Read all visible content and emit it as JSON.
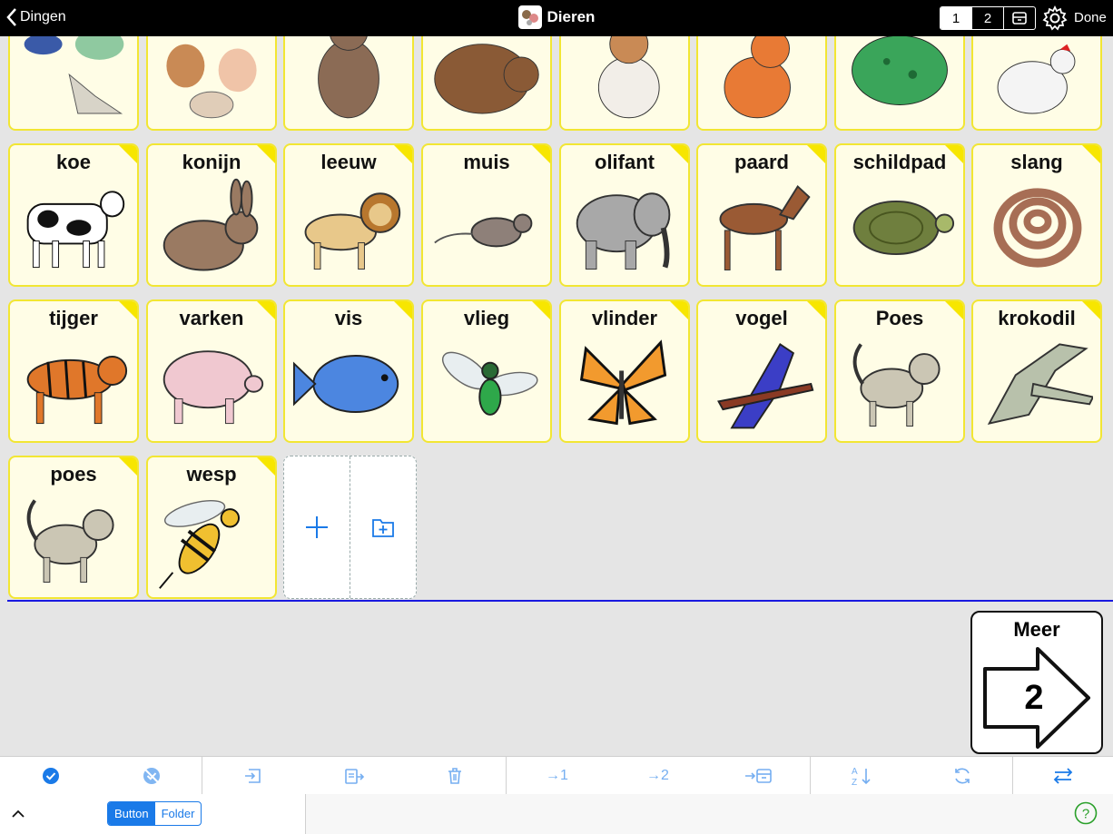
{
  "topbar": {
    "back_label": "Dingen",
    "title": "Dieren",
    "pages": [
      "1",
      "2"
    ],
    "selected_page": "1",
    "done_label": "Done"
  },
  "grid": {
    "row_partial": [
      {
        "id": "top-1",
        "label": ""
      },
      {
        "id": "top-2",
        "label": ""
      },
      {
        "id": "top-3",
        "label": ""
      },
      {
        "id": "top-4",
        "label": ""
      },
      {
        "id": "top-5",
        "label": ""
      },
      {
        "id": "top-6",
        "label": ""
      },
      {
        "id": "top-7",
        "label": ""
      },
      {
        "id": "top-8",
        "label": ""
      }
    ],
    "cells": [
      {
        "label": "koe"
      },
      {
        "label": "konijn"
      },
      {
        "label": "leeuw"
      },
      {
        "label": "muis"
      },
      {
        "label": "olifant"
      },
      {
        "label": "paard"
      },
      {
        "label": "schildpad"
      },
      {
        "label": "slang"
      },
      {
        "label": "tijger"
      },
      {
        "label": "varken"
      },
      {
        "label": "vis"
      },
      {
        "label": "vlieg"
      },
      {
        "label": "vlinder"
      },
      {
        "label": "vogel"
      },
      {
        "label": "Poes"
      },
      {
        "label": "krokodil"
      },
      {
        "label": "poes"
      },
      {
        "label": "wesp"
      }
    ]
  },
  "meer": {
    "label": "Meer",
    "page_number": "2"
  },
  "toolbar": {
    "move_to_1": "→1",
    "move_to_2": "→2"
  },
  "bottom": {
    "segment": [
      "Button",
      "Folder"
    ],
    "selected_segment": "Button"
  },
  "colors": {
    "accent": "#1a7ae8",
    "cell_bg": "#fffde6",
    "cell_border": "#f2e633",
    "divider": "#1a1ae0"
  }
}
